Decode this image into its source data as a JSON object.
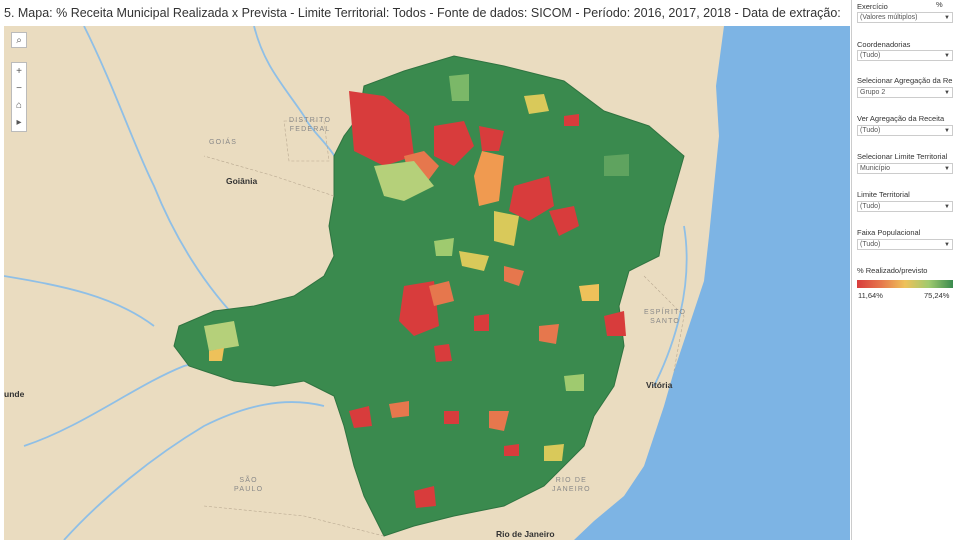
{
  "header": {
    "title": "5. Mapa: % Receita Municipal Realizada x Prevista - Limite Territorial: Todos - Fonte de dados: SICOM - Período: 2016, 2017, 2018 - Data de extração: 28/03/2019 06:01:58"
  },
  "map": {
    "controls": {
      "search": "⌕",
      "zoom_in": "+",
      "zoom_out": "−",
      "home": "⌂",
      "expand": "▸"
    },
    "places": {
      "goiania": "Goiânia",
      "goias": "GOIÁS",
      "df_line1": "DISTRITO",
      "df_line2": "FEDERAL",
      "es_line1": "ESPÍRITO",
      "es_line2": "SANTO",
      "vitoria": "Vitória",
      "sp_line1": "SÃO",
      "sp_line2": "PAULO",
      "rj_line1": "RIO DE",
      "rj_line2": "JANEIRO",
      "rio": "Rio de Janeiro",
      "left_edge": "unde"
    },
    "colors": {
      "water": "#7db4e4",
      "land": "#eadcc0",
      "state_fill": "#3a8a4e",
      "low": "#d83c3c",
      "mid": "#eec15a",
      "high": "#3a8a4e"
    }
  },
  "filters": [
    {
      "label": "Exercício",
      "value": "(Valores múltiplos)"
    },
    {
      "label": "Coordenadorias",
      "value": "(Tudo)"
    },
    {
      "label": "Selecionar Agregação da Re",
      "value": "Grupo 2"
    },
    {
      "label": "Ver Agregação da Receita",
      "value": "(Tudo)"
    },
    {
      "label": "Selecionar Limite Territorial",
      "value": "Município"
    },
    {
      "label": "Limite Territorial",
      "value": "(Tudo)"
    },
    {
      "label": "Faixa Populacional",
      "value": "(Tudo)"
    }
  ],
  "exercise_short": "%",
  "legend": {
    "title": "% Realizado/previsto",
    "min": "11,64%",
    "max": "75,24%"
  }
}
